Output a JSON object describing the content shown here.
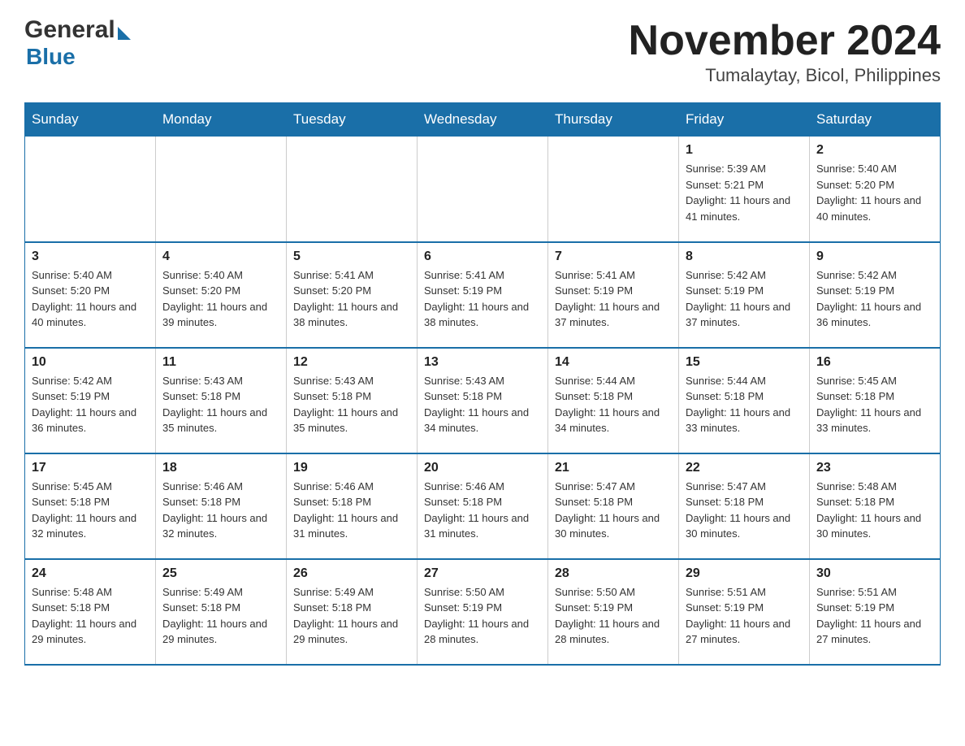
{
  "logo": {
    "general": "General",
    "blue": "Blue"
  },
  "header": {
    "month_year": "November 2024",
    "location": "Tumalaytay, Bicol, Philippines"
  },
  "days_of_week": [
    "Sunday",
    "Monday",
    "Tuesday",
    "Wednesday",
    "Thursday",
    "Friday",
    "Saturday"
  ],
  "weeks": [
    [
      {
        "day": "",
        "info": ""
      },
      {
        "day": "",
        "info": ""
      },
      {
        "day": "",
        "info": ""
      },
      {
        "day": "",
        "info": ""
      },
      {
        "day": "",
        "info": ""
      },
      {
        "day": "1",
        "info": "Sunrise: 5:39 AM\nSunset: 5:21 PM\nDaylight: 11 hours and 41 minutes."
      },
      {
        "day": "2",
        "info": "Sunrise: 5:40 AM\nSunset: 5:20 PM\nDaylight: 11 hours and 40 minutes."
      }
    ],
    [
      {
        "day": "3",
        "info": "Sunrise: 5:40 AM\nSunset: 5:20 PM\nDaylight: 11 hours and 40 minutes."
      },
      {
        "day": "4",
        "info": "Sunrise: 5:40 AM\nSunset: 5:20 PM\nDaylight: 11 hours and 39 minutes."
      },
      {
        "day": "5",
        "info": "Sunrise: 5:41 AM\nSunset: 5:20 PM\nDaylight: 11 hours and 38 minutes."
      },
      {
        "day": "6",
        "info": "Sunrise: 5:41 AM\nSunset: 5:19 PM\nDaylight: 11 hours and 38 minutes."
      },
      {
        "day": "7",
        "info": "Sunrise: 5:41 AM\nSunset: 5:19 PM\nDaylight: 11 hours and 37 minutes."
      },
      {
        "day": "8",
        "info": "Sunrise: 5:42 AM\nSunset: 5:19 PM\nDaylight: 11 hours and 37 minutes."
      },
      {
        "day": "9",
        "info": "Sunrise: 5:42 AM\nSunset: 5:19 PM\nDaylight: 11 hours and 36 minutes."
      }
    ],
    [
      {
        "day": "10",
        "info": "Sunrise: 5:42 AM\nSunset: 5:19 PM\nDaylight: 11 hours and 36 minutes."
      },
      {
        "day": "11",
        "info": "Sunrise: 5:43 AM\nSunset: 5:18 PM\nDaylight: 11 hours and 35 minutes."
      },
      {
        "day": "12",
        "info": "Sunrise: 5:43 AM\nSunset: 5:18 PM\nDaylight: 11 hours and 35 minutes."
      },
      {
        "day": "13",
        "info": "Sunrise: 5:43 AM\nSunset: 5:18 PM\nDaylight: 11 hours and 34 minutes."
      },
      {
        "day": "14",
        "info": "Sunrise: 5:44 AM\nSunset: 5:18 PM\nDaylight: 11 hours and 34 minutes."
      },
      {
        "day": "15",
        "info": "Sunrise: 5:44 AM\nSunset: 5:18 PM\nDaylight: 11 hours and 33 minutes."
      },
      {
        "day": "16",
        "info": "Sunrise: 5:45 AM\nSunset: 5:18 PM\nDaylight: 11 hours and 33 minutes."
      }
    ],
    [
      {
        "day": "17",
        "info": "Sunrise: 5:45 AM\nSunset: 5:18 PM\nDaylight: 11 hours and 32 minutes."
      },
      {
        "day": "18",
        "info": "Sunrise: 5:46 AM\nSunset: 5:18 PM\nDaylight: 11 hours and 32 minutes."
      },
      {
        "day": "19",
        "info": "Sunrise: 5:46 AM\nSunset: 5:18 PM\nDaylight: 11 hours and 31 minutes."
      },
      {
        "day": "20",
        "info": "Sunrise: 5:46 AM\nSunset: 5:18 PM\nDaylight: 11 hours and 31 minutes."
      },
      {
        "day": "21",
        "info": "Sunrise: 5:47 AM\nSunset: 5:18 PM\nDaylight: 11 hours and 30 minutes."
      },
      {
        "day": "22",
        "info": "Sunrise: 5:47 AM\nSunset: 5:18 PM\nDaylight: 11 hours and 30 minutes."
      },
      {
        "day": "23",
        "info": "Sunrise: 5:48 AM\nSunset: 5:18 PM\nDaylight: 11 hours and 30 minutes."
      }
    ],
    [
      {
        "day": "24",
        "info": "Sunrise: 5:48 AM\nSunset: 5:18 PM\nDaylight: 11 hours and 29 minutes."
      },
      {
        "day": "25",
        "info": "Sunrise: 5:49 AM\nSunset: 5:18 PM\nDaylight: 11 hours and 29 minutes."
      },
      {
        "day": "26",
        "info": "Sunrise: 5:49 AM\nSunset: 5:18 PM\nDaylight: 11 hours and 29 minutes."
      },
      {
        "day": "27",
        "info": "Sunrise: 5:50 AM\nSunset: 5:19 PM\nDaylight: 11 hours and 28 minutes."
      },
      {
        "day": "28",
        "info": "Sunrise: 5:50 AM\nSunset: 5:19 PM\nDaylight: 11 hours and 28 minutes."
      },
      {
        "day": "29",
        "info": "Sunrise: 5:51 AM\nSunset: 5:19 PM\nDaylight: 11 hours and 27 minutes."
      },
      {
        "day": "30",
        "info": "Sunrise: 5:51 AM\nSunset: 5:19 PM\nDaylight: 11 hours and 27 minutes."
      }
    ]
  ]
}
